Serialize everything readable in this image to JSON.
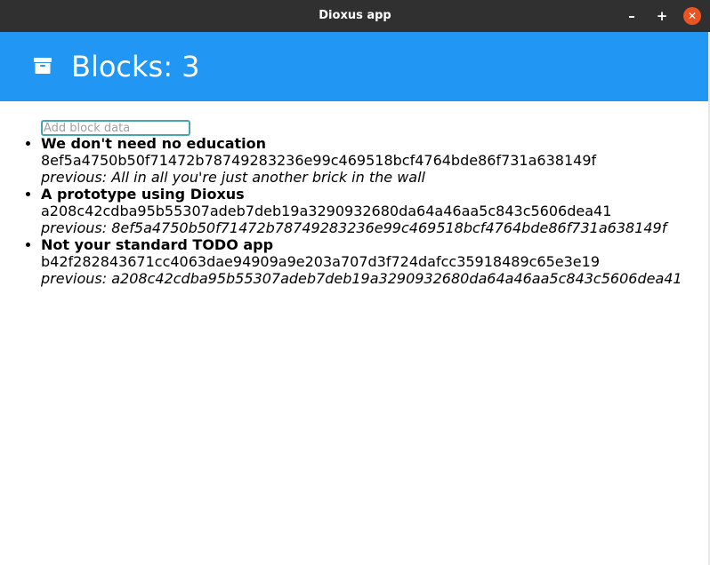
{
  "window": {
    "title": "Dioxus app",
    "controls": {
      "minimize": "–",
      "maximize": "+",
      "close": "✕"
    }
  },
  "header": {
    "icon": "archive-icon",
    "title": "Blocks: 3",
    "background": "#2196f3"
  },
  "input": {
    "placeholder": "Add block data",
    "value": ""
  },
  "blocks": [
    {
      "data": "We don't need no education",
      "hash": "8ef5a4750b50f71472b78749283236e99c469518bcf4764bde86f731a638149f",
      "previous": "previous: All in all you're just another brick in the wall"
    },
    {
      "data": "A prototype using Dioxus",
      "hash": "a208c42cdba95b55307adeb7deb19a3290932680da64a46aa5c843c5606dea41",
      "previous": "previous: 8ef5a4750b50f71472b78749283236e99c469518bcf4764bde86f731a638149f"
    },
    {
      "data": "Not your standard TODO app",
      "hash": "b42f282843671cc4063dae94909a9e203a707d3f724dafcc35918489c65e3e19",
      "previous": "previous: a208c42cdba95b55307adeb7deb19a3290932680da64a46aa5c843c5606dea41"
    }
  ]
}
